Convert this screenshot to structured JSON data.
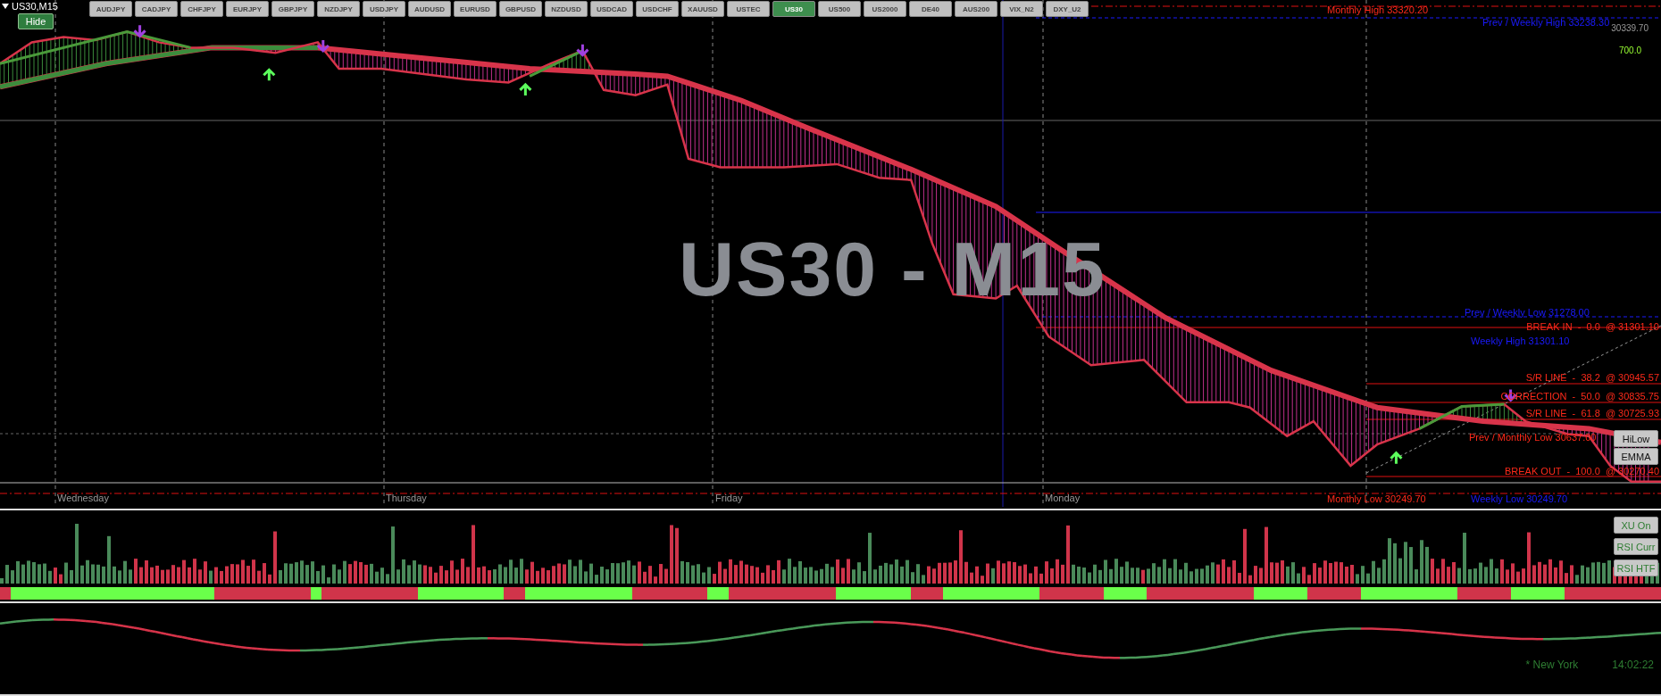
{
  "chart_title": "US30,M15",
  "hide_button": "Hide",
  "symbols": [
    {
      "label": "AUDJPY",
      "selected": false
    },
    {
      "label": "CADJPY",
      "selected": false
    },
    {
      "label": "CHFJPY",
      "selected": false
    },
    {
      "label": "EURJPY",
      "selected": false
    },
    {
      "label": "GBPJPY",
      "selected": false
    },
    {
      "label": "NZDJPY",
      "selected": false
    },
    {
      "label": "USDJPY",
      "selected": false
    },
    {
      "label": "AUDUSD",
      "selected": false
    },
    {
      "label": "EURUSD",
      "selected": false
    },
    {
      "label": "GBPUSD",
      "selected": false
    },
    {
      "label": "NZDUSD",
      "selected": false
    },
    {
      "label": "USDCAD",
      "selected": false
    },
    {
      "label": "USDCHF",
      "selected": false
    },
    {
      "label": "XAUUSD",
      "selected": false
    },
    {
      "label": "USTEC",
      "selected": false
    },
    {
      "label": "US30",
      "selected": true
    },
    {
      "label": "US500",
      "selected": false
    },
    {
      "label": "US2000",
      "selected": false
    },
    {
      "label": "DE40",
      "selected": false
    },
    {
      "label": "AUS200",
      "selected": false
    },
    {
      "label": "VIX_N2",
      "selected": false
    },
    {
      "label": "DXY_U2",
      "selected": false
    }
  ],
  "chart_label": "US30 - M15",
  "price_axis": [
    "30339.70"
  ],
  "indicator_axis": [
    "700.0"
  ],
  "level_labels": [
    {
      "text": "Monthly High 33320.20",
      "color": "#ff2a1a"
    },
    {
      "text": "Prev / Weekly High 33238.30",
      "color": "#1a1aff"
    },
    {
      "text": "Prev / Weekly Low 31278.00",
      "color": "#1a1aff"
    },
    {
      "text": "BREAK IN  -  0.0  @ 31301.10",
      "color": "#ff2a1a"
    },
    {
      "text": "Weekly High 31301.10",
      "color": "#1a1aff"
    },
    {
      "text": "S/R LINE  -  38.2  @ 30945.57",
      "color": "#ff2a1a"
    },
    {
      "text": "CORRECTION  -  50.0  @ 30835.75",
      "color": "#ff2a1a"
    },
    {
      "text": "S/R LINE  -  61.8  @ 30725.93",
      "color": "#ff2a1a"
    },
    {
      "text": "Prev / Monthly Low 30637.00",
      "color": "#ff2a1a"
    },
    {
      "text": "BREAK OUT  -  100.0  @ 30270.40",
      "color": "#ff2a1a"
    },
    {
      "text": "Monthly Low 30249.70",
      "color": "#ff2a1a"
    },
    {
      "text": "Weekly Low 30249.70",
      "color": "#1a1aff"
    }
  ],
  "day_labels": [
    "Wednesday",
    "Thursday",
    "Friday",
    "Monday"
  ],
  "chart_buttons": [
    "HiLow",
    "EMMA"
  ],
  "panel_buttons": [
    "XU On",
    "RSI Curr",
    "RSI HTF"
  ],
  "clock": {
    "city": "* New York",
    "time": "14:02:22"
  }
}
